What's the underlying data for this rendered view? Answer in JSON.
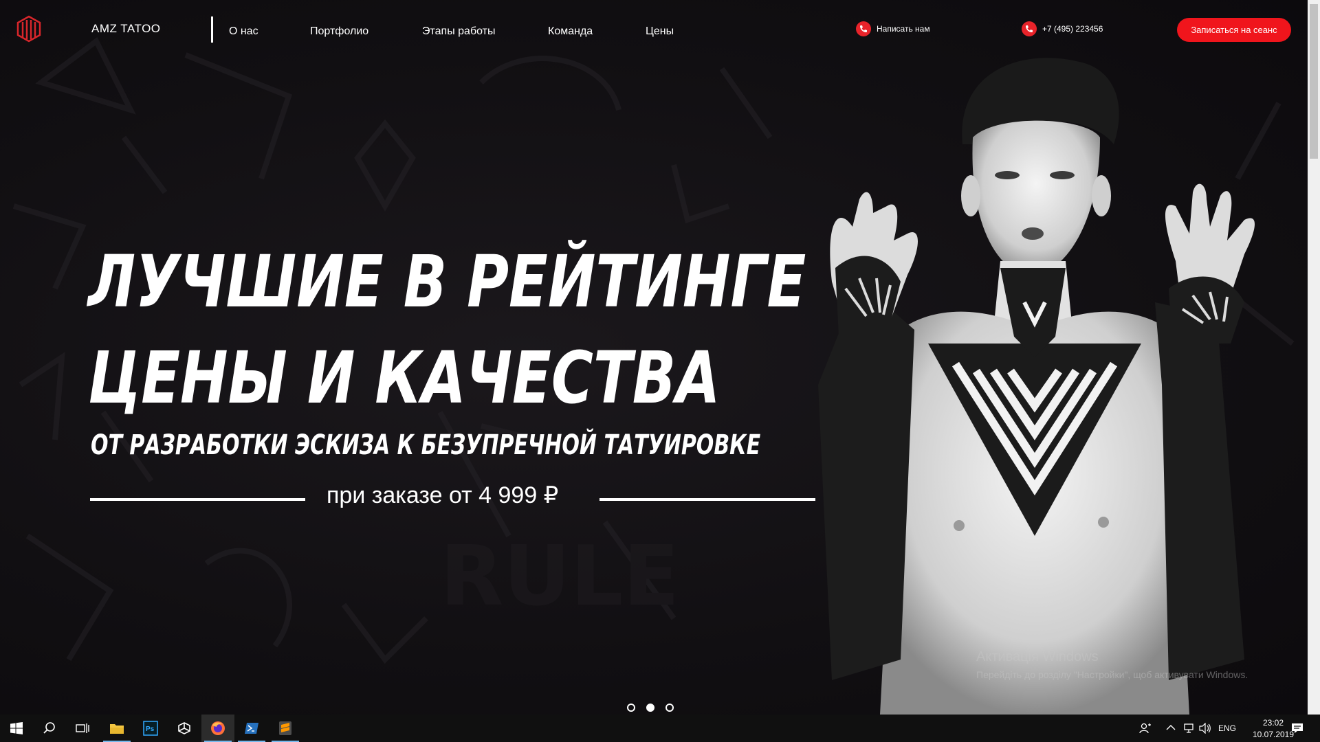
{
  "header": {
    "brand": "AMZ TATOO",
    "nav": [
      "О нас",
      "Портфолио",
      "Этапы работы",
      "Команда",
      "Цены"
    ],
    "contact_message": "Написать нам",
    "contact_phone": "+7 (495) 223456",
    "cta_label": "Записаться на сеанс"
  },
  "hero": {
    "headline_line1": "ЛУЧШИЕ В РЕЙТИНГЕ",
    "headline_line2": "ЦЕНЫ И КАЧЕСТВА",
    "subheadline": "ОТ РАЗРАБОТКИ ЭСКИЗА К БЕЗУПРЕЧНОЙ ТАТУИРОВКЕ",
    "price": "при заказе от 4 999 ₽",
    "slides_total": 3,
    "active_slide": 2
  },
  "watermark": {
    "line1": "Активація Windows",
    "line2": "Перейдіть до розділу \"Настройки\", щоб активувати Windows."
  },
  "taskbar": {
    "language": "ENG",
    "time": "23:02",
    "date": "10.07.2019",
    "apps": [
      "start",
      "search",
      "task-view",
      "file-explorer",
      "photoshop",
      "unity",
      "firefox",
      "powershell",
      "sublime-text"
    ]
  },
  "colors": {
    "accent": "#f0151c",
    "background": "#110f12"
  }
}
